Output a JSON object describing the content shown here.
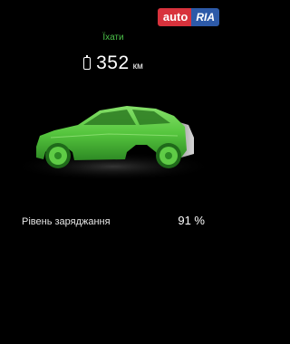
{
  "watermark": {
    "part1": "auto",
    "part2": "RIA"
  },
  "status": {
    "label": "Їхати"
  },
  "range": {
    "value": "352",
    "unit": "км"
  },
  "battery": {
    "label": "Рівень заряджання",
    "value": "91 %"
  },
  "colors": {
    "accent_green": "#4cc24a",
    "car_body": "#56c63e",
    "background": "#000000",
    "watermark_red": "#d8323c",
    "watermark_blue": "#2d5aa8"
  },
  "icons": {
    "range": "battery-icon",
    "car": "car-illustration"
  }
}
